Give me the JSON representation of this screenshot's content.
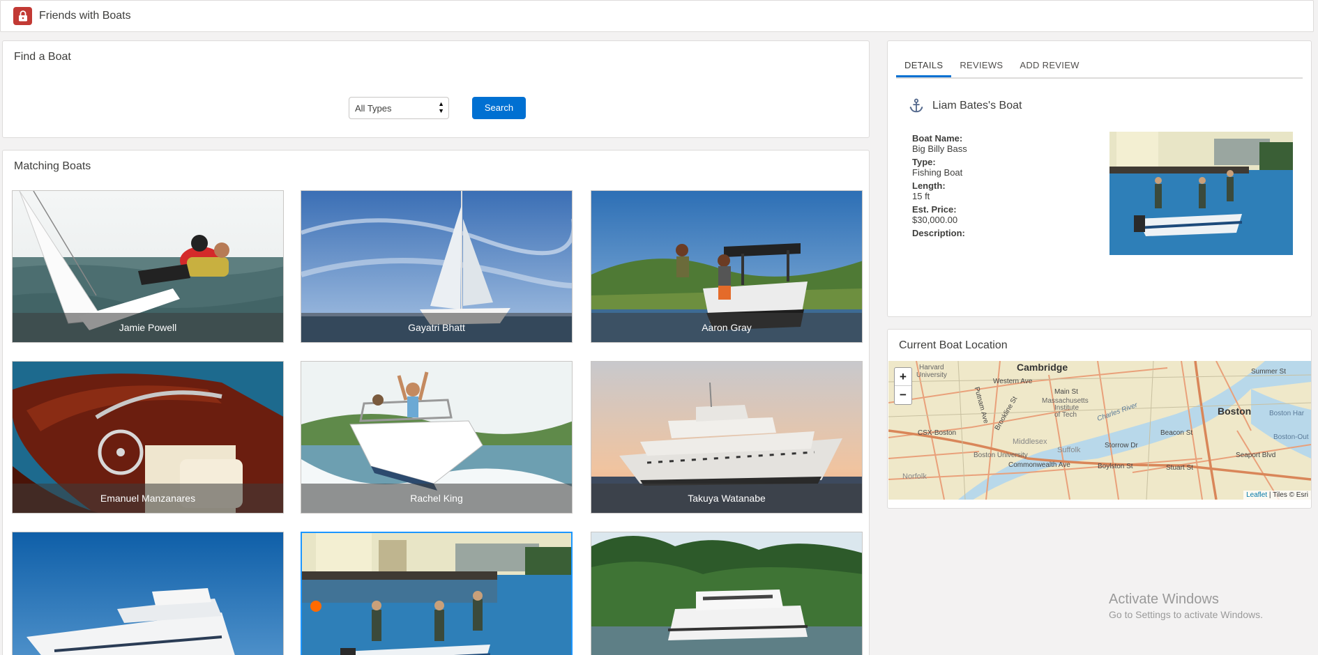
{
  "app": {
    "title": "Friends with Boats",
    "icon": "lock-icon",
    "brand_color": "#c23934"
  },
  "find": {
    "title": "Find a Boat",
    "type_select_value": "All Types",
    "search_label": "Search",
    "accent": "#0070d2"
  },
  "matching": {
    "title": "Matching Boats",
    "tiles": [
      {
        "owner": "Jamie Powell"
      },
      {
        "owner": "Gayatri Bhatt"
      },
      {
        "owner": "Aaron Gray"
      },
      {
        "owner": "Emanuel Manzanares"
      },
      {
        "owner": "Rachel King"
      },
      {
        "owner": "Takuya Watanabe"
      },
      {
        "owner": ""
      },
      {
        "owner": ""
      },
      {
        "owner": ""
      }
    ]
  },
  "details": {
    "tabs": [
      "DETAILS",
      "REVIEWS",
      "ADD REVIEW"
    ],
    "active_tab": "DETAILS",
    "header_icon": "anchor-icon",
    "title": "Liam Bates's Boat",
    "fields": {
      "boat_name_label": "Boat Name:",
      "boat_name": "Big Billy Bass",
      "type_label": "Type:",
      "type": "Fishing Boat",
      "length_label": "Length:",
      "length": "15 ft",
      "price_label": "Est. Price:",
      "price": "$30,000.00",
      "description_label": "Description:"
    }
  },
  "map": {
    "title": "Current Boat Location",
    "zoom_in": "+",
    "zoom_out": "−",
    "labels": {
      "cambridge": "Cambridge",
      "boston": "Boston",
      "harvard": "Harvard",
      "harvard2": "University",
      "mit1": "Massachusetts",
      "mit2": "Institute",
      "mit3": "of Tech",
      "western": "Western Ave",
      "main": "Main St",
      "charles": "Charles River",
      "csx": "CSX-Boston",
      "middlesex": "Middlesex",
      "suffolk": "Suffolk",
      "storrow": "Storrow Dr",
      "beacon": "Beacon St",
      "boylston": "Boylston St",
      "commonwealth": "Commonwealth Ave",
      "bu": "Boston University",
      "norfolk": "Norfolk",
      "stuart": "Stuart St",
      "harbor": "Boston Har",
      "seaport": "Seaport Blvd",
      "summer": "Summer St",
      "brookline": "Brookline St",
      "putnam": "Putnam Ave",
      "boston_outer": "Boston-Out"
    },
    "attribution_link": "Leaflet",
    "attribution_text": " | Tiles © Esri"
  },
  "watermark": {
    "title": "Activate Windows",
    "subtitle": "Go to Settings to activate Windows."
  }
}
